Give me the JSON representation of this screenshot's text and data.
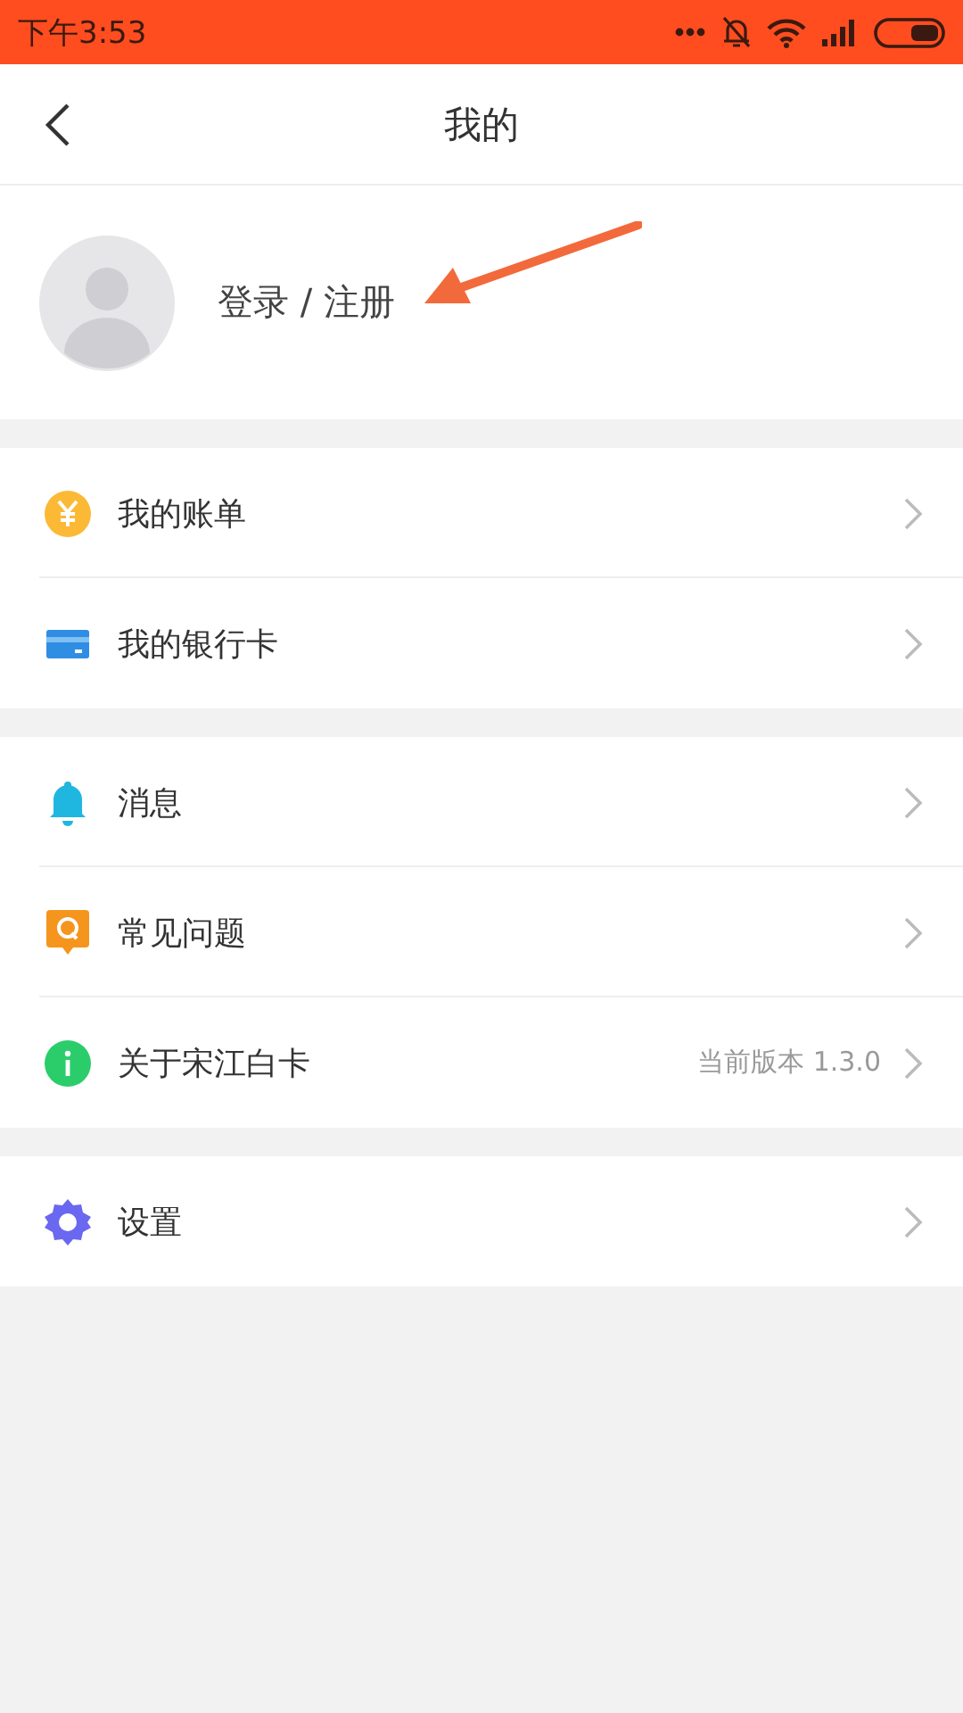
{
  "status_bar": {
    "time": "下午3:53"
  },
  "header": {
    "title": "我的"
  },
  "profile": {
    "login_label": "登录 / 注册"
  },
  "menu_groups": [
    {
      "items": [
        {
          "kind": "bill",
          "label": "我的账单"
        },
        {
          "kind": "card",
          "label": "我的银行卡"
        }
      ]
    },
    {
      "items": [
        {
          "kind": "bell",
          "label": "消息"
        },
        {
          "kind": "faq",
          "label": "常见问题"
        },
        {
          "kind": "info",
          "label": "关于宋江白卡",
          "detail": "当前版本 1.3.0"
        }
      ]
    },
    {
      "items": [
        {
          "kind": "gear",
          "label": "设置"
        }
      ]
    }
  ]
}
